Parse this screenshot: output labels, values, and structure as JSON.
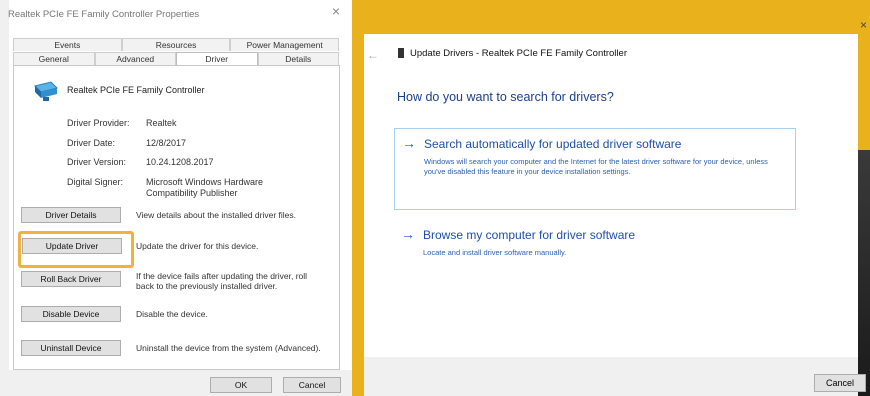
{
  "dialog": {
    "title": "Realtek PCIe FE Family Controller Properties",
    "close": "×",
    "tabs_row1": [
      "Events",
      "Resources",
      "Power Management"
    ],
    "tabs_row2": [
      "General",
      "Advanced",
      "Driver",
      "Details"
    ],
    "active_tab": "Driver",
    "device_name": "Realtek PCIe FE Family Controller",
    "properties": [
      {
        "label": "Driver Provider:",
        "value": "Realtek"
      },
      {
        "label": "Driver Date:",
        "value": "12/8/2017"
      },
      {
        "label": "Driver Version:",
        "value": "10.24.1208.2017"
      },
      {
        "label": "Digital Signer:",
        "value": "Microsoft Windows Hardware Compatibility Publisher"
      }
    ],
    "actions": [
      {
        "button": "Driver Details",
        "desc": "View details about the installed driver files."
      },
      {
        "button": "Update Driver",
        "desc": "Update the driver for this device."
      },
      {
        "button": "Roll Back Driver",
        "desc": "If the device fails after updating the driver, roll back to the previously installed driver."
      },
      {
        "button": "Disable Device",
        "desc": "Disable the device."
      },
      {
        "button": "Uninstall Device",
        "desc": "Uninstall the device from the system (Advanced)."
      }
    ],
    "ok": "OK",
    "cancel": "Cancel"
  },
  "wizard": {
    "close": "×",
    "back": "←",
    "title": "Update Drivers - Realtek PCIe FE Family Controller",
    "question": "How do you want to search for drivers?",
    "options": [
      {
        "arrow": "→",
        "title": "Search automatically for updated driver software",
        "desc": "Windows will search your computer and the Internet for the latest driver software for your device, unless you've disabled this feature in your device installation settings."
      },
      {
        "arrow": "→",
        "title": "Browse my computer for driver software",
        "desc": "Locate and install driver software manually."
      }
    ],
    "cancel": "Cancel"
  },
  "colors": {
    "highlight": "#f0b23a",
    "wizard_border": "#e9b21c",
    "link_blue": "#1e4fa8"
  }
}
